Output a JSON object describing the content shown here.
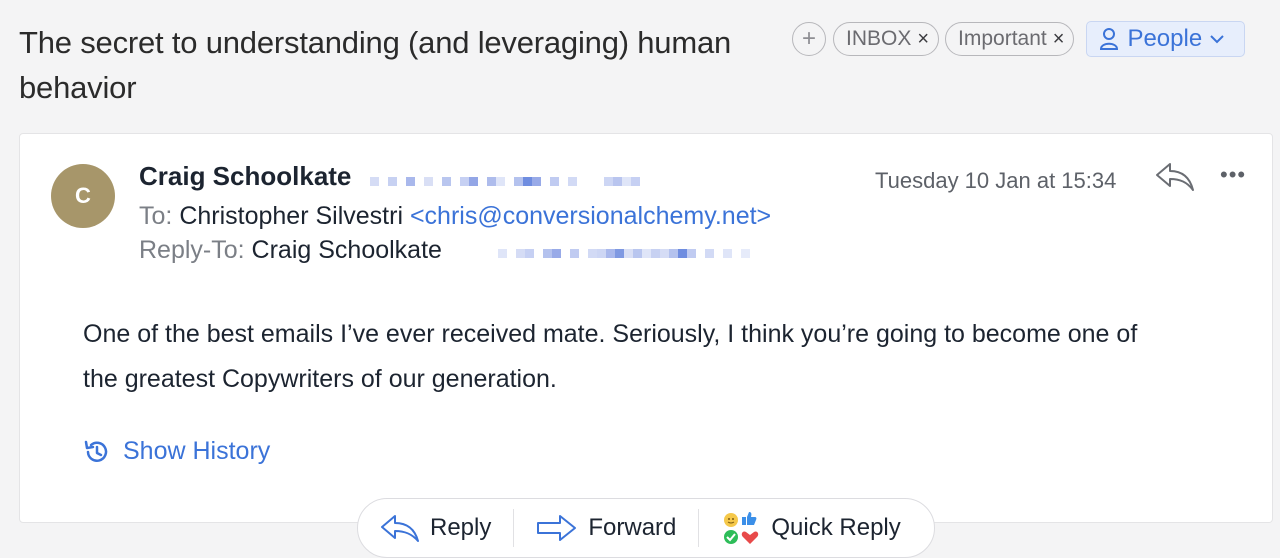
{
  "subject": "The secret to understanding (and leveraging) human behavior",
  "labels": {
    "add": "+",
    "chips": [
      {
        "text": "INBOX",
        "remove": "×"
      },
      {
        "text": "Important",
        "remove": "×"
      }
    ]
  },
  "people_button": "People",
  "message": {
    "avatar_initial": "C",
    "avatar_color": "#a7966a",
    "from_name": "Craig Schoolkate",
    "date": "Tuesday 10 Jan at 15:34",
    "to_label": "To:",
    "to_name": "Christopher Silvestri",
    "to_address": "<chris@conversionalchemy.net>",
    "reply_to_label": "Reply-To:",
    "reply_to_name": "Craig Schoolkate",
    "more": "•••",
    "body": "One of the best emails I’ve ever received mate. Seriously, I think you’re going to become one of the greatest Copywriters of our generation.",
    "show_history": "Show History"
  },
  "actions": {
    "reply": "Reply",
    "forward": "Forward",
    "quick_reply": "Quick Reply"
  },
  "colors": {
    "accent": "#3b73d8",
    "background": "#f4f4f5"
  }
}
